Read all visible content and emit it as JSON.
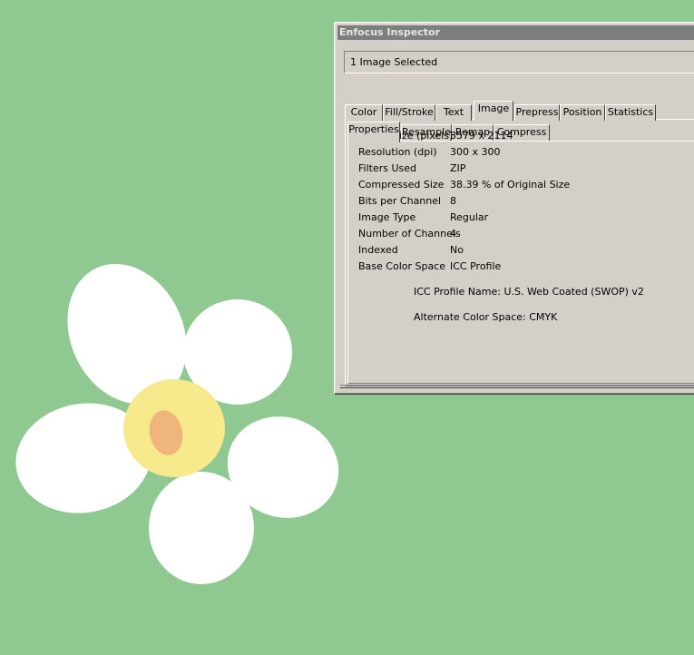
{
  "window": {
    "title": "Enfocus Inspector"
  },
  "selection": {
    "text": "1 Image Selected"
  },
  "tabs": [
    "Color",
    "Fill/Stroke",
    "Text",
    "Image",
    "Prepress",
    "Position",
    "Statistics"
  ],
  "active_tab": "Image",
  "subtabs": [
    "Properties",
    "Resample",
    "Remap",
    "Compress"
  ],
  "active_subtab": "Properties",
  "properties": [
    {
      "label": "Image Size (pixels)",
      "value": "3579 x 2114"
    },
    {
      "label": "Resolution (dpi)",
      "value": "300 x 300"
    },
    {
      "label": "Filters Used",
      "value": "ZIP"
    },
    {
      "label": "Compressed Size",
      "value": "38.39 % of Original Size"
    },
    {
      "label": "Bits per Channel",
      "value": "8"
    },
    {
      "label": "Image Type",
      "value": "Regular"
    },
    {
      "label": "Number of Channels",
      "value": "4"
    },
    {
      "label": "Indexed",
      "value": "No"
    },
    {
      "label": "Base Color Space",
      "value": "ICC Profile"
    }
  ],
  "icc_profile": "ICC Profile Name: U.S. Web Coated (SWOP) v2",
  "alternate_color_space": "Alternate Color Space: CMYK",
  "colors": {
    "background": "#8fc991",
    "petal": "#ffffff",
    "center": "#f6ea8c",
    "pistil": "#f0b57a",
    "dialog": "#d4d0c8",
    "titlebar": "#7e7e7e"
  }
}
